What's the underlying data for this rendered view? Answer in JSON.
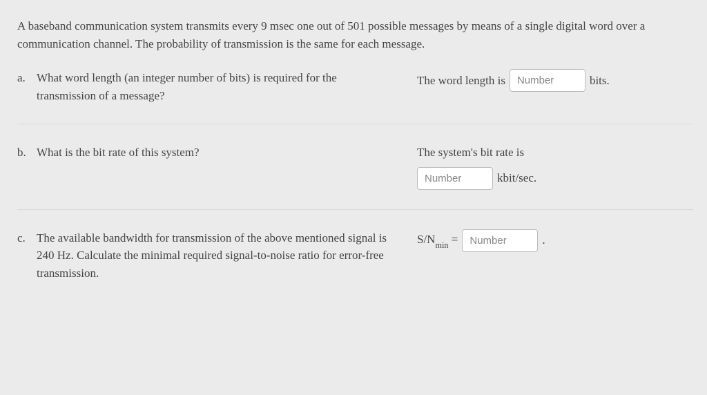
{
  "intro": "A baseband communication system transmits every 9 msec one out of 501 possible messages by means of a single digital word over a communication channel. The probability of transmission is the same for each message.",
  "parts": {
    "a": {
      "label": "a.",
      "question": "What word length (an integer number of bits) is required for the transmission of a message?",
      "answer_prefix": "The word length is",
      "placeholder": "Number",
      "answer_suffix": "bits."
    },
    "b": {
      "label": "b.",
      "question": "What is the bit rate of this system?",
      "answer_lead": "The system's bit rate is",
      "placeholder": "Number",
      "answer_suffix": "kbit/sec."
    },
    "c": {
      "label": "c.",
      "question": "The available bandwidth for transmission of the above mentioned signal is 240 Hz. Calculate the minimal required signal-to-noise ratio for error-free transmission.",
      "answer_prefix_main": "S/N",
      "answer_prefix_sub": "min",
      "answer_equals": " = ",
      "placeholder": "Number",
      "answer_suffix": "."
    }
  }
}
